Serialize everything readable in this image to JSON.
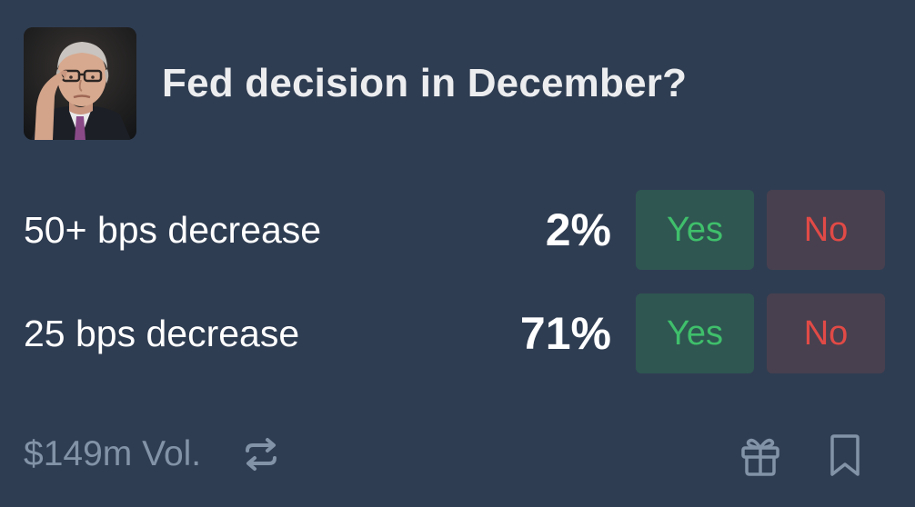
{
  "market": {
    "title": "Fed decision in December?"
  },
  "outcomes": [
    {
      "label": "50+ bps decrease",
      "probability": "2%",
      "yes_label": "Yes",
      "no_label": "No"
    },
    {
      "label": "25 bps decrease",
      "probability": "71%",
      "yes_label": "Yes",
      "no_label": "No"
    }
  ],
  "footer": {
    "volume": "$149m Vol.",
    "icons": [
      "repeat-icon",
      "gift-icon",
      "bookmark-icon"
    ]
  },
  "colors": {
    "background": "#2f3d52",
    "yes_text": "#3fbf6b",
    "yes_bg": "#2f5651",
    "no_text": "#e14a46",
    "no_bg": "#48404f",
    "muted": "#8393a7"
  }
}
